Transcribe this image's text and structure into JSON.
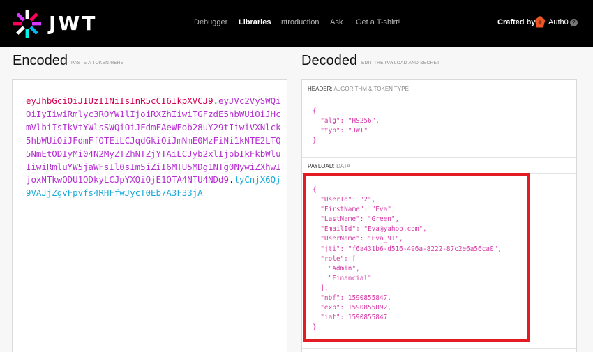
{
  "brand": {
    "name": "JWT"
  },
  "nav": {
    "items": [
      {
        "label": "Debugger",
        "active": false
      },
      {
        "label": "Libraries",
        "active": true
      },
      {
        "label": "Introduction",
        "active": false
      },
      {
        "label": "Ask",
        "active": false
      },
      {
        "label": "Get a T-shirt!",
        "active": false
      }
    ],
    "crafted_by": "Crafted by",
    "sponsor": "Auth0",
    "info": "?"
  },
  "encoded": {
    "title": "Encoded",
    "subtitle": "PASTE A TOKEN HERE",
    "token_header": "eyJhbGciOiJIUzI1NiIsInR5cCI6IkpXVCJ9",
    "token_payload": "eyJVc2VySWQiOiIyIiwiRmlyc3ROYW1lIjoiRXZhIiwiTGFzdE5hbWUiOiJHcmVlbiIsIkVtYWlsSWQiOiJFdmFAeWFob28uY29tIiwiVXNlck5hbWUiOiJFdmFfOTEiLCJqdGkiOiJmNmE0MzFiNi1kNTE2LTQ5NmEtODIyMi04N2MyZTZhNTZjYTAiLCJyb2xlIjpbIkFkbWluIiwiRmluYW5jaWFsIl0sIm5iZiI6MTU5MDg1NTg0NywiZXhwIjoxNTkwODU1ODkyLCJpYXQiOjE1OTA4NTU4NDd9",
    "token_signature": "tyCnjX6Qj9VAJjZgvFpvfs4RHFfwJycT0Eb7A3F33jA",
    "dot": "."
  },
  "decoded": {
    "title": "Decoded",
    "subtitle": "EDIT THE PAYLOAD AND SECRET",
    "header_label": "HEADER:",
    "header_sub": "ALGORITHM & TOKEN TYPE",
    "payload_label": "PAYLOAD:",
    "payload_sub": "DATA",
    "header_json": [
      "{",
      "  \"alg\": \"HS256\",",
      "  \"typ\": \"JWT\"",
      "}"
    ],
    "payload_json": [
      "{",
      "  \"UserId\": \"2\",",
      "  \"FirstName\": \"Eva\",",
      "  \"LastName\": \"Green\",",
      "  \"EmailId\": \"Eva@yahoo.com\",",
      "  \"UserName\": \"Eva_91\",",
      "  \"jti\": \"f6a431b6-d516-496a-8222-87c2e6a56ca0\",",
      "  \"role\": [",
      "    \"Admin\",",
      "    \"Financial\"",
      "  ],",
      "  \"nbf\": 1590855847,",
      "  \"exp\": 1590855892,",
      "  \"iat\": 1590855847",
      "}"
    ]
  },
  "colors": {
    "highlight_box": "#e31b23",
    "token_header": "#d3004f",
    "token_payload": "#b62fd1",
    "token_signature": "#1aa9d9",
    "json_text": "#d63aa6"
  }
}
